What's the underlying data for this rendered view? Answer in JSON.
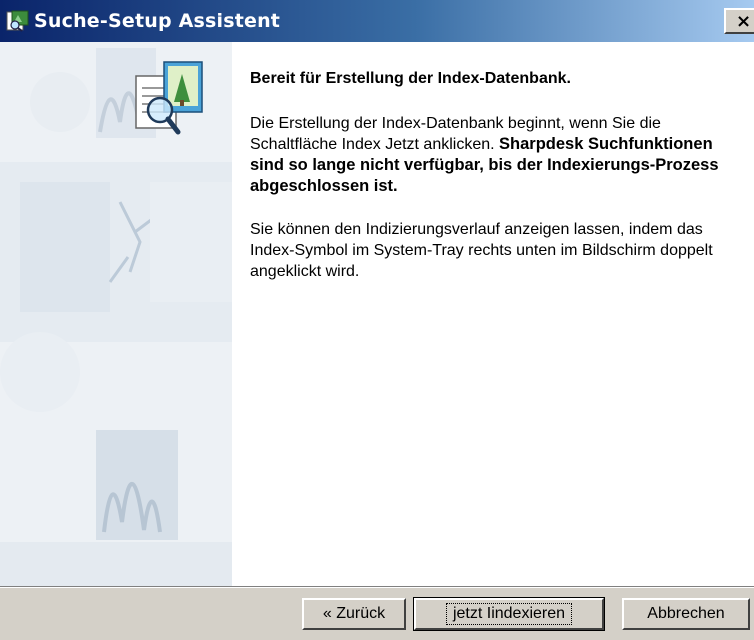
{
  "window": {
    "title": "Suche-Setup Assistent",
    "close_glyph": "×"
  },
  "content": {
    "heading": "Bereit für Erstellung der Index-Datenbank.",
    "para1_normal": "Die Erstellung der Index-Datenbank beginnt, wenn Sie die Schaltfläche Index Jetzt anklicken. ",
    "para1_bold": "Sharpdesk Suchfunktionen sind so lange nicht verfügbar, bis der Indexierungs-Prozess abgeschlossen ist.",
    "para2": "Sie können den Indizierungsverlauf anzeigen lassen, indem das Index-Symbol im System-Tray rechts unten im Bildschirm doppelt angeklickt wird."
  },
  "buttons": {
    "back": "« Zurück",
    "index": "jetzt Iindexieren",
    "cancel": "Abbrechen"
  },
  "icons": {
    "title": "setup-wizard-icon",
    "wizard": "document-search-icon"
  },
  "colors": {
    "titlebar_start": "#0a246a",
    "titlebar_end": "#a6caf0",
    "dialog_bg": "#d4d0c8"
  }
}
